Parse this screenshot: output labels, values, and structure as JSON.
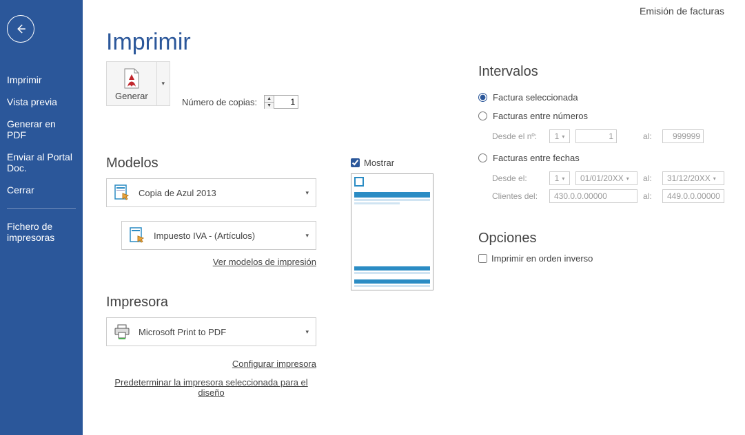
{
  "app": {
    "title_right": "Emisión de facturas"
  },
  "sidebar": {
    "items": [
      {
        "label": "Imprimir"
      },
      {
        "label": "Vista previa"
      },
      {
        "label": "Generar en PDF"
      },
      {
        "label": "Enviar al Portal Doc."
      },
      {
        "label": "Cerrar"
      }
    ],
    "footer": {
      "label": "Fichero de impresoras"
    }
  },
  "page": {
    "title": "Imprimir"
  },
  "generate": {
    "button_label": "Generar",
    "copies_label": "Número de copias:",
    "copies_value": "1"
  },
  "models": {
    "heading": "Modelos",
    "design_name": "Copia de Azul 2013",
    "subdesign_name": "Impuesto IVA - (Artículos)",
    "view_link": "Ver modelos de impresión"
  },
  "preview": {
    "show_label": "Mostrar"
  },
  "printer": {
    "heading": "Impresora",
    "name": "Microsoft Print to PDF",
    "config_link": "Configurar impresora",
    "default_link": "Predeterminar la impresora seleccionada para el diseño"
  },
  "intervals": {
    "heading": "Intervalos",
    "selected_label": "Factura seleccionada",
    "between_numbers_label": "Facturas entre números",
    "from_num_label": "Desde el nº:",
    "serie1": "1",
    "num_from": "1",
    "num_to": "999999",
    "al": "al:",
    "between_dates_label": "Facturas entre fechas",
    "from_date_label": "Desde el:",
    "serie2": "1",
    "date_from": "01/01/20XX",
    "date_to": "31/12/20XX",
    "clients_label": "Clientes del:",
    "client_from": "430.0.0.00000",
    "client_to": "449.0.0.00000"
  },
  "options": {
    "heading": "Opciones",
    "reverse_label": "Imprimir en orden inverso"
  }
}
